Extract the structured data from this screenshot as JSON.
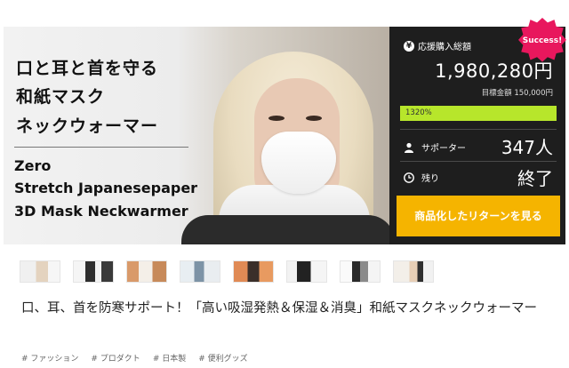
{
  "hero": {
    "title_lines": [
      "口と耳と首を守る",
      "和紙マスク",
      "ネックウォーマー"
    ],
    "en_lines": [
      "Zero",
      "Stretch Japanesepaper",
      "3D Mask Neckwarmer"
    ]
  },
  "panel": {
    "raised_label": "応援購入総額",
    "raised_amount": "1,980,280円",
    "goal_text": "目標金額 150,000円",
    "progress_text": "1320%",
    "progress_fraction": 1.0,
    "supporters_label": "サポーター",
    "supporters_value": "347人",
    "remaining_label": "残り",
    "remaining_value": "終了",
    "cta_label": "商品化したリターンを見る",
    "badge": "Success!",
    "icons": [
      "yen-icon",
      "person-icon",
      "clock-icon"
    ]
  },
  "thumbnails": [
    "thumb-1",
    "thumb-2",
    "thumb-3",
    "thumb-4",
    "thumb-5",
    "thumb-6",
    "thumb-7",
    "thumb-8"
  ],
  "project": {
    "title": "口、耳、首を防寒サポート！「高い吸湿発熱＆保湿＆消臭」和紙マスクネックウォーマー"
  },
  "tags": [
    "# ファッション",
    "# プロダクト",
    "# 日本製",
    "# 便利グッズ"
  ],
  "colors": {
    "accent": "#f5b400",
    "progress": "#b7e62b",
    "badge": "#e8175d",
    "panel": "#1e1e1e"
  }
}
